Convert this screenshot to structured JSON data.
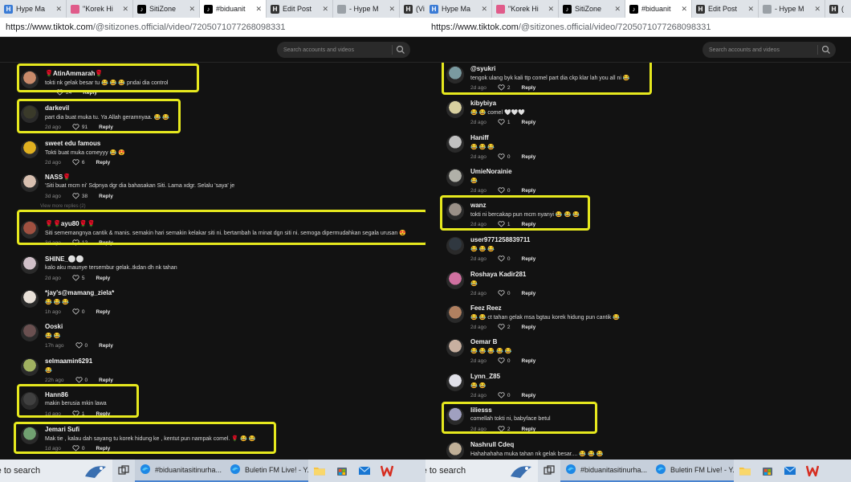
{
  "browser": {
    "tabs": [
      {
        "label": "Hype Ma",
        "icon": "hype-favicon",
        "color": "#3a7bd5"
      },
      {
        "label": "\"Korek Hi",
        "icon": "korek-favicon",
        "color": "#e05b8a"
      },
      {
        "label": "SitiZone",
        "icon": "tiktok-icon",
        "color": "#000000"
      },
      {
        "label": "#biduanit",
        "icon": "tiktok-icon",
        "color": "#000000",
        "active": true
      },
      {
        "label": "Edit Post",
        "icon": "hype-favicon",
        "color": "#333333"
      },
      {
        "label": "- Hype M",
        "icon": "page-icon",
        "color": "#9aa0a6"
      },
      {
        "label": "(Vi",
        "icon": "hype-favicon",
        "color": "#333333"
      }
    ],
    "tabs_right": [
      {
        "label": "Hype Ma",
        "icon": "hype-favicon",
        "color": "#3a7bd5"
      },
      {
        "label": "\"Korek Hi",
        "icon": "korek-favicon",
        "color": "#e05b8a"
      },
      {
        "label": "SitiZone",
        "icon": "tiktok-icon",
        "color": "#000000"
      },
      {
        "label": "#biduanit",
        "icon": "tiktok-icon",
        "color": "#000000",
        "active": true
      },
      {
        "label": "Edit Post",
        "icon": "hype-favicon",
        "color": "#333333"
      },
      {
        "label": "- Hype M",
        "icon": "page-icon",
        "color": "#9aa0a6"
      },
      {
        "label": "(",
        "icon": "hype-favicon",
        "color": "#333333"
      }
    ],
    "url_host": "https://www.tiktok.com",
    "url_path": "/@sitizones.official/video/7205071077268098331"
  },
  "search": {
    "placeholder": "Search accounts and videos"
  },
  "left_comments": [
    {
      "user": "🌹AtinAmmarah🌹",
      "text": "tokti nk gelak besar tu 😂 😂 😂 pndai dia control",
      "time": "",
      "likes": "24",
      "reply": "Reply",
      "avatar": "#c98a6a"
    },
    {
      "user": "darkevil",
      "text": "part dia buat muka tu. Ya Allah geramnyaa. 😂 😂",
      "time": "2d ago",
      "likes": "91",
      "reply": "Reply",
      "avatar": "#3a3a2a"
    },
    {
      "user": "sweet edu famous",
      "text": "Tokti buat muka comeyyy 😂 😍",
      "time": "2d ago",
      "likes": "6",
      "reply": "Reply",
      "avatar": "#e0b020"
    },
    {
      "user": "NASS🌹",
      "text": "'Siti buat mcm ni' Sdpnya dgr dia bahasakan Siti. Lama xdgr. Selalu 'saya' je",
      "time": "3d ago",
      "likes": "38",
      "reply": "Reply",
      "avatar": "#d8c0b0"
    },
    {
      "user": "🌹🌹ayu80🌹🌹",
      "text": "Siti sememangnya cantik & manis. semakin hari semakin kelakar siti ni. bertambah la minat dgn siti ni. semoga dipermudahkan segala urusan 😍",
      "time": "3d ago",
      "likes": "12",
      "reply": "Reply",
      "avatar": "#a05040"
    },
    {
      "user": "SHINE_⚪⚪",
      "text": "kalo aku maunye tersembur gelak..tkdan dh nk tahan",
      "time": "2d ago",
      "likes": "5",
      "reply": "Reply",
      "avatar": "#d0c0c8"
    },
    {
      "user": "*jay's@mamang_ziela*",
      "text": "😂 😂 😂",
      "time": "1h ago",
      "likes": "0",
      "reply": "Reply",
      "avatar": "#e8e0d8"
    },
    {
      "user": "Ooski",
      "text": "😂 😂",
      "time": "17h ago",
      "likes": "0",
      "reply": "Reply",
      "avatar": "#6a5050"
    },
    {
      "user": "selmaamin6291",
      "text": "😂",
      "time": "22h ago",
      "likes": "0",
      "reply": "Reply",
      "avatar": "#a0b060"
    },
    {
      "user": "Hann86",
      "text": "makin berusia mkin lawa",
      "time": "1d ago",
      "likes": "1",
      "reply": "Reply",
      "avatar": "#404040"
    },
    {
      "user": "Jemari Sufi",
      "text": "Mak tie , kalau dah sayang tu korek hidung ke , kentut pun nampak comel. 🌹 😂 😂",
      "time": "1d ago",
      "likes": "0",
      "reply": "Reply",
      "avatar": "#70a070"
    }
  ],
  "view_more_label": "View more replies (2)",
  "right_comments": [
    {
      "user": "@syukri",
      "text": "tengok ulang byk kali ttp comel part dia ckp klar lah you all ni 😂",
      "time": "2d ago",
      "likes": "2",
      "reply": "Reply",
      "avatar": "#7a9aa0"
    },
    {
      "user": "kibybiya",
      "text": "😂 😂 comel 🤍🤍🤍",
      "time": "2d ago",
      "likes": "1",
      "reply": "Reply",
      "avatar": "#d8d0a0"
    },
    {
      "user": "Haniff",
      "text": "😂 😂 😂",
      "time": "2d ago",
      "likes": "0",
      "reply": "Reply",
      "avatar": "#c0c0c0"
    },
    {
      "user": "UmieNorainie",
      "text": "😂",
      "time": "2d ago",
      "likes": "0",
      "reply": "Reply",
      "avatar": "#b0b0a8"
    },
    {
      "user": "wanz",
      "text": "tokti ni bercakap pun mcm nyanyi 😂 😂 😂",
      "time": "2d ago",
      "likes": "1",
      "reply": "Reply",
      "avatar": "#9a9088"
    },
    {
      "user": "user9771258839711",
      "text": "😂 😂 😂",
      "time": "2d ago",
      "likes": "0",
      "reply": "Reply",
      "avatar": "#303840"
    },
    {
      "user": "Roshaya Kadir281",
      "text": "😂",
      "time": "2d ago",
      "likes": "0",
      "reply": "Reply",
      "avatar": "#d070a0"
    },
    {
      "user": "Feez Reez",
      "text": "😂 😂 ct tahan gelak msa bgtau korek hidung pun cantik 😂",
      "time": "2d ago",
      "likes": "2",
      "reply": "Reply",
      "avatar": "#b08060"
    },
    {
      "user": "Oemar B",
      "text": "😂 😂 😂 😂 😂",
      "time": "2d ago",
      "likes": "0",
      "reply": "Reply",
      "avatar": "#c8b0a0"
    },
    {
      "user": "Lynn_Z85",
      "text": "😂 😂",
      "time": "2d ago",
      "likes": "0",
      "reply": "Reply",
      "avatar": "#e0e0e8"
    },
    {
      "user": "liliesss",
      "text": "comellah tokti ni, babyface betul",
      "time": "2d ago",
      "likes": "2",
      "reply": "Reply",
      "avatar": "#a0a0c0"
    },
    {
      "user": "Nashrull Cdeq",
      "text": "Hahahahaha muka tahan nk gelak besar.... 😂 😂 😂",
      "time": "",
      "likes": "",
      "reply": "",
      "avatar": "#c0b098"
    }
  ],
  "taskbar": {
    "search_text": "re to search",
    "apps": [
      {
        "label": "#biduanitasitinurha...",
        "icon": "edge-icon"
      },
      {
        "label": "Buletin FM Live! - Y...",
        "icon": "edge-icon"
      }
    ],
    "icons": [
      "task-view-icon",
      "file-explorer-icon",
      "store-icon",
      "mail-icon",
      "wps-icon"
    ]
  }
}
